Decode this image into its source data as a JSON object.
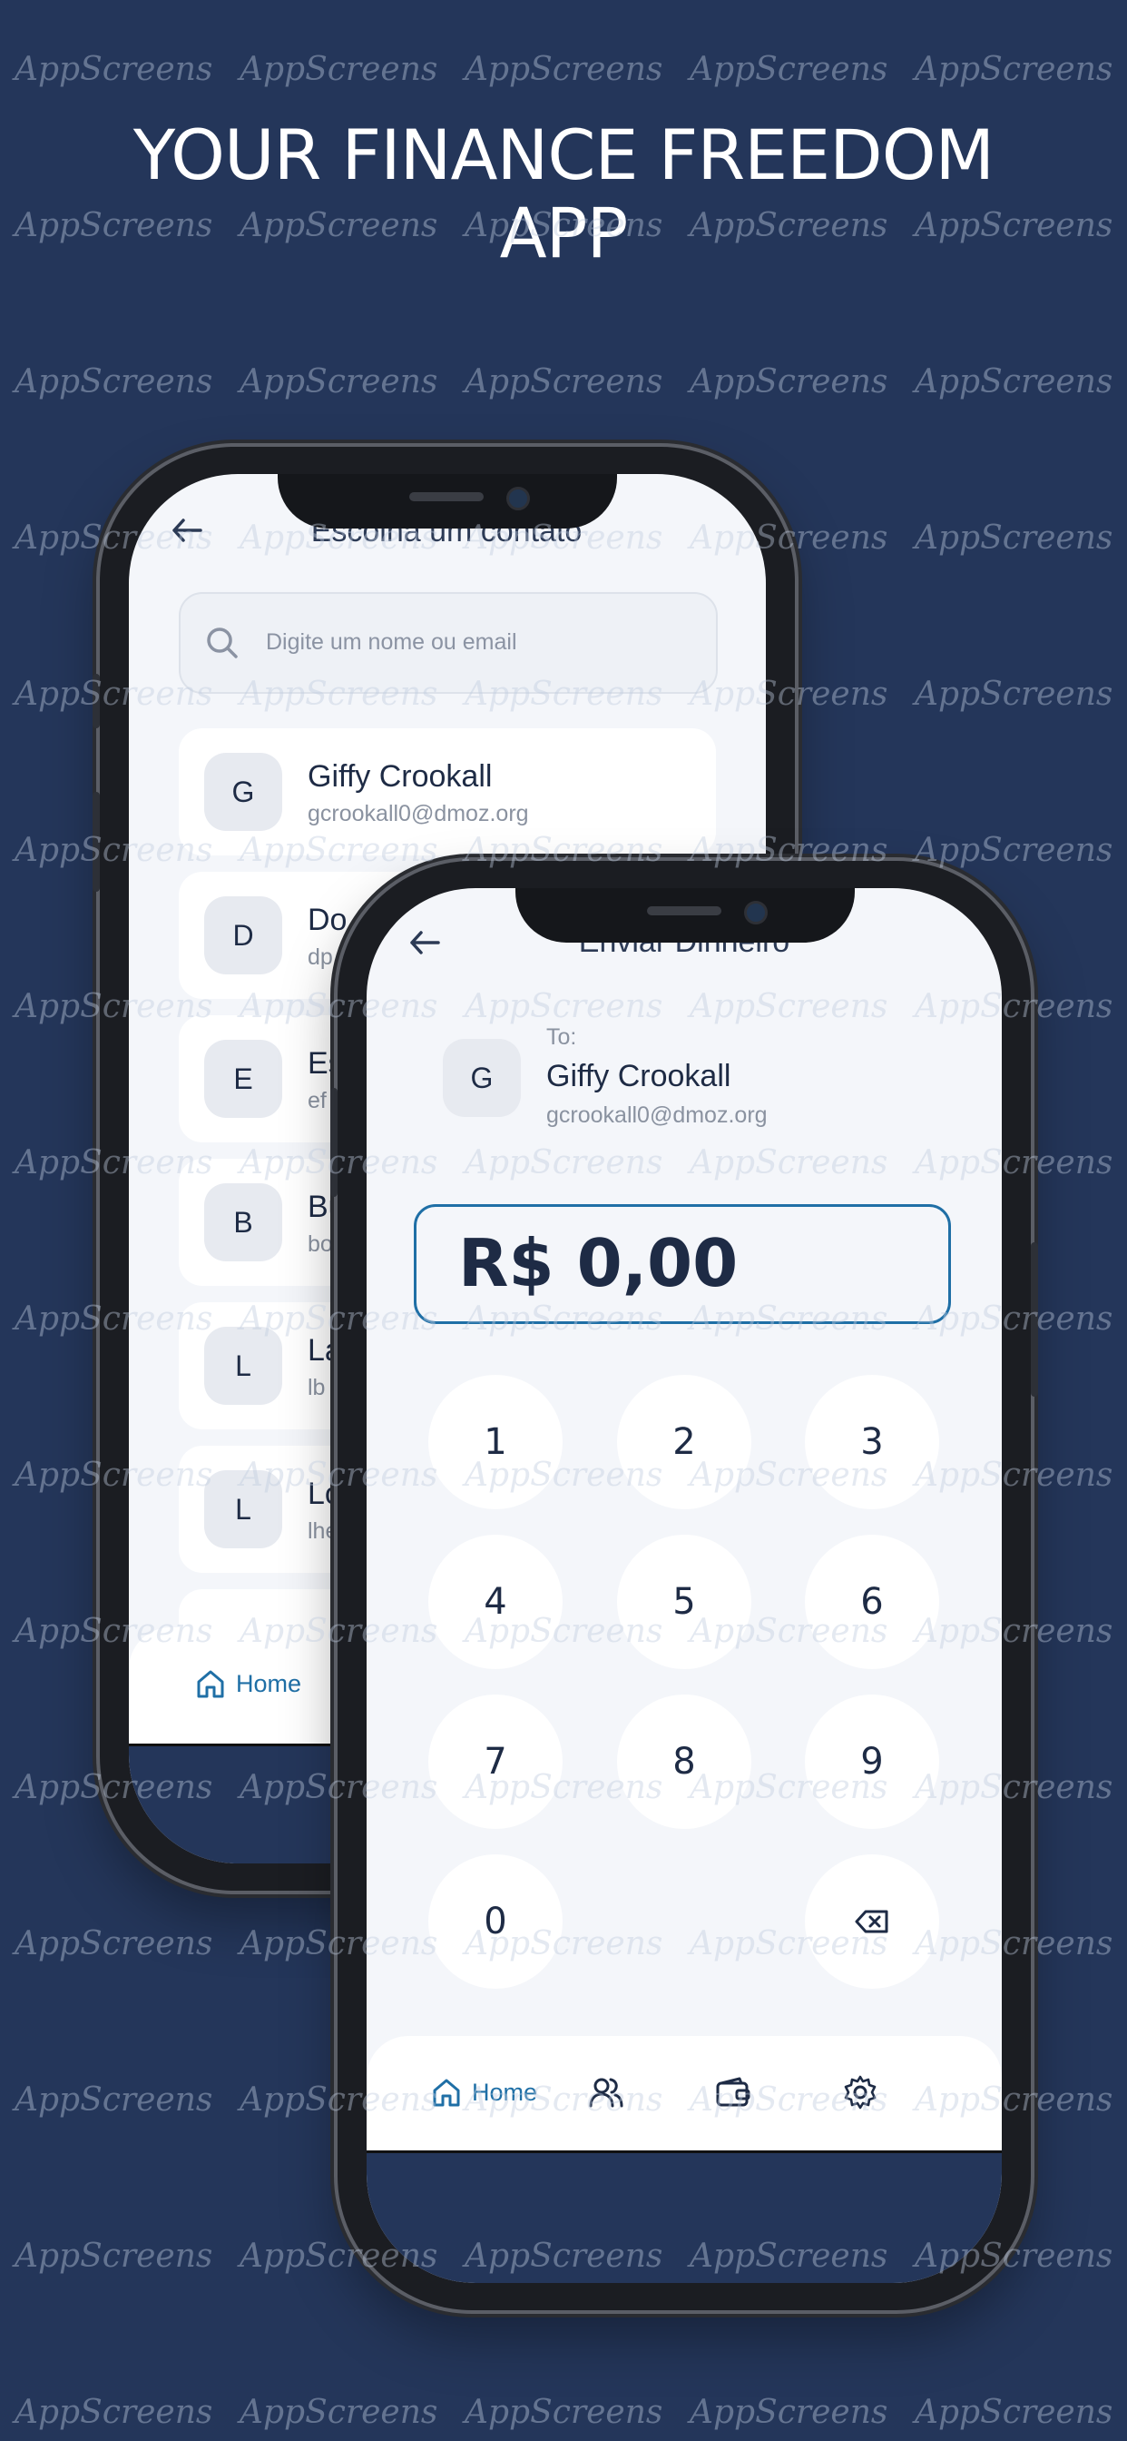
{
  "headline": {
    "line1": "YOUR FINANCE FREEDOM",
    "line2": "APP"
  },
  "watermark": "AppScreens",
  "contacts_screen": {
    "title": "Escolha um contato",
    "search_placeholder": "Digite um nome ou email",
    "contacts": [
      {
        "initial": "G",
        "name": "Giffy Crookall",
        "email": "gcrookall0@dmoz.org"
      },
      {
        "initial": "D",
        "name": "Do",
        "email": "dp"
      },
      {
        "initial": "E",
        "name": "Es",
        "email": "ef"
      },
      {
        "initial": "B",
        "name": "Bu",
        "email": "bo"
      },
      {
        "initial": "L",
        "name": "La",
        "email": "lb"
      },
      {
        "initial": "L",
        "name": "Lo",
        "email": "lhe"
      }
    ],
    "nav": {
      "home_label": "Home"
    }
  },
  "send_screen": {
    "title": "Enviar Dinheiro",
    "to_label": "To:",
    "recipient": {
      "initial": "G",
      "name": "Giffy Crookall",
      "email": "gcrookall0@dmoz.org"
    },
    "amount": "R$ 0,00",
    "keys": [
      "1",
      "2",
      "3",
      "4",
      "5",
      "6",
      "7",
      "8",
      "9",
      "0"
    ],
    "nav": {
      "home_label": "Home"
    }
  },
  "colors": {
    "background": "#24365a",
    "accent": "#1f6fa6",
    "text_dark": "#1e2b45"
  },
  "icons": [
    "back-arrow-icon",
    "search-icon",
    "home-icon",
    "users-icon",
    "wallet-icon",
    "settings-icon",
    "backspace-icon"
  ]
}
